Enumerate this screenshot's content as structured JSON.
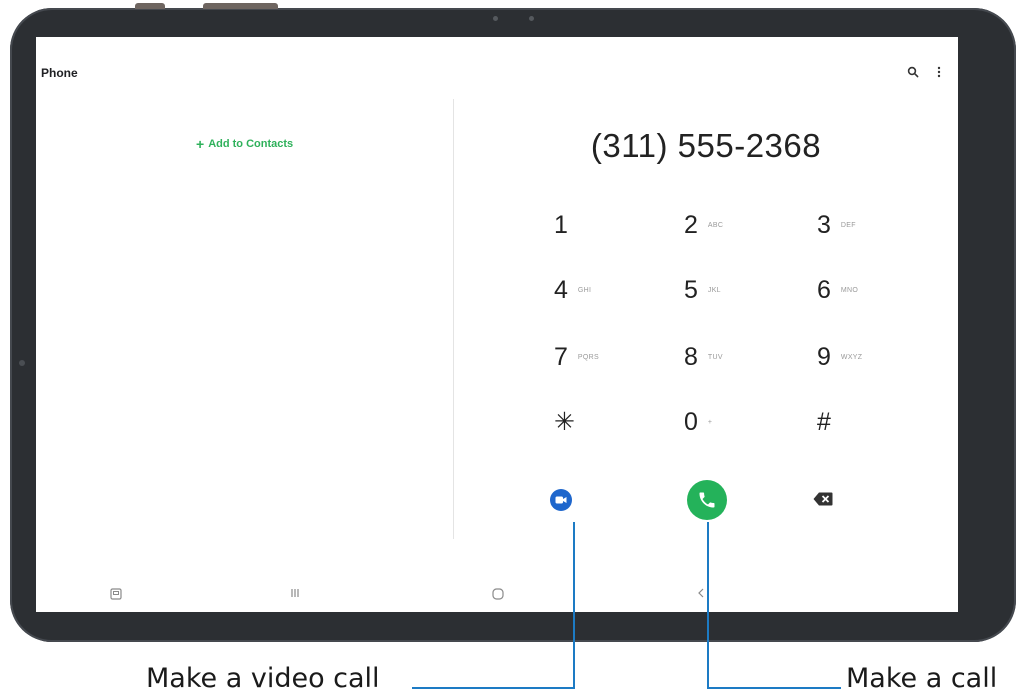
{
  "app": {
    "title": "Phone"
  },
  "top_bar": {
    "search_icon": "search-icon",
    "more_icon": "more-options-icon"
  },
  "left_pane": {
    "add_to_contacts": "Add to Contacts"
  },
  "dialer": {
    "number": "(311) 555-2368",
    "keys": [
      {
        "digit": "1",
        "letters": ""
      },
      {
        "digit": "2",
        "letters": "ABC"
      },
      {
        "digit": "3",
        "letters": "DEF"
      },
      {
        "digit": "4",
        "letters": "GHI"
      },
      {
        "digit": "5",
        "letters": "JKL"
      },
      {
        "digit": "6",
        "letters": "MNO"
      },
      {
        "digit": "7",
        "letters": "PQRS"
      },
      {
        "digit": "8",
        "letters": "TUV"
      },
      {
        "digit": "9",
        "letters": "WXYZ"
      },
      {
        "digit": "✳",
        "letters": ""
      },
      {
        "digit": "0",
        "letters": "+"
      },
      {
        "digit": "#",
        "letters": ""
      }
    ],
    "video_call_icon": "video-camera-icon",
    "call_icon": "phone-icon",
    "backspace_icon": "backspace-icon"
  },
  "colors": {
    "accent_green": "#24b25a",
    "video_blue": "#1e66cc",
    "callout_line": "#1d7bc4"
  },
  "callouts": {
    "video_call": "Make a video call",
    "call": "Make a call"
  }
}
